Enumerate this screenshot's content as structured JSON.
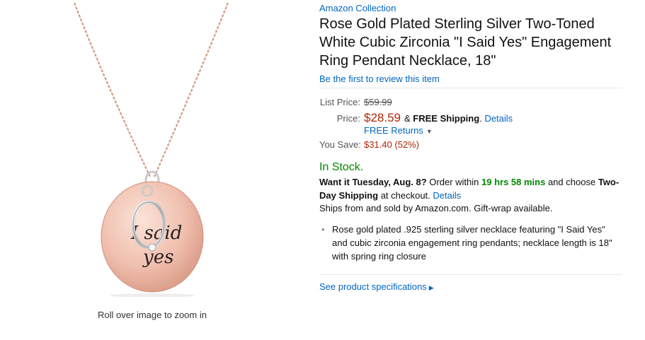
{
  "gallery": {
    "zoom_hint": "Roll over image to zoom in",
    "pendant_engraving_line1": "I said",
    "pendant_engraving_line2": "yes"
  },
  "product": {
    "brand": "Amazon Collection",
    "title": "Rose Gold Plated Sterling Silver Two-Toned White Cubic Zirconia \"I Said Yes\" Engagement Ring Pendant Necklace, 18\"",
    "review_link": "Be the first to review this item"
  },
  "pricing": {
    "list_price_label": "List Price:",
    "list_price": "$59.99",
    "price_label": "Price:",
    "price": "$28.59",
    "shipping_connector": "&",
    "free_shipping": "FREE Shipping",
    "shipping_period": ".",
    "details_link": "Details",
    "free_returns": "FREE Returns",
    "you_save_label": "You Save:",
    "you_save": "$31.40 (52%)"
  },
  "availability": {
    "stock": "In Stock.",
    "want_it": "Want it Tuesday, Aug. 8?",
    "order_within": "Order within",
    "countdown": "19 hrs 58 mins",
    "and_choose": "and choose",
    "shipping_option": "Two-Day Shipping",
    "at_checkout": "at checkout.",
    "details_link": "Details",
    "ships_from": "Ships from and sold by Amazon.com. Gift-wrap available."
  },
  "features": [
    "Rose gold plated .925 sterling silver necklace featuring \"I Said Yes\" and cubic zirconia engagement ring pendants; necklace length is 18\" with spring ring closure"
  ],
  "specs_link": "See product specifications",
  "colors": {
    "link": "#0066c0",
    "price": "#b12704",
    "in_stock": "#008a00",
    "rose_gold": "#e8b2a0"
  }
}
